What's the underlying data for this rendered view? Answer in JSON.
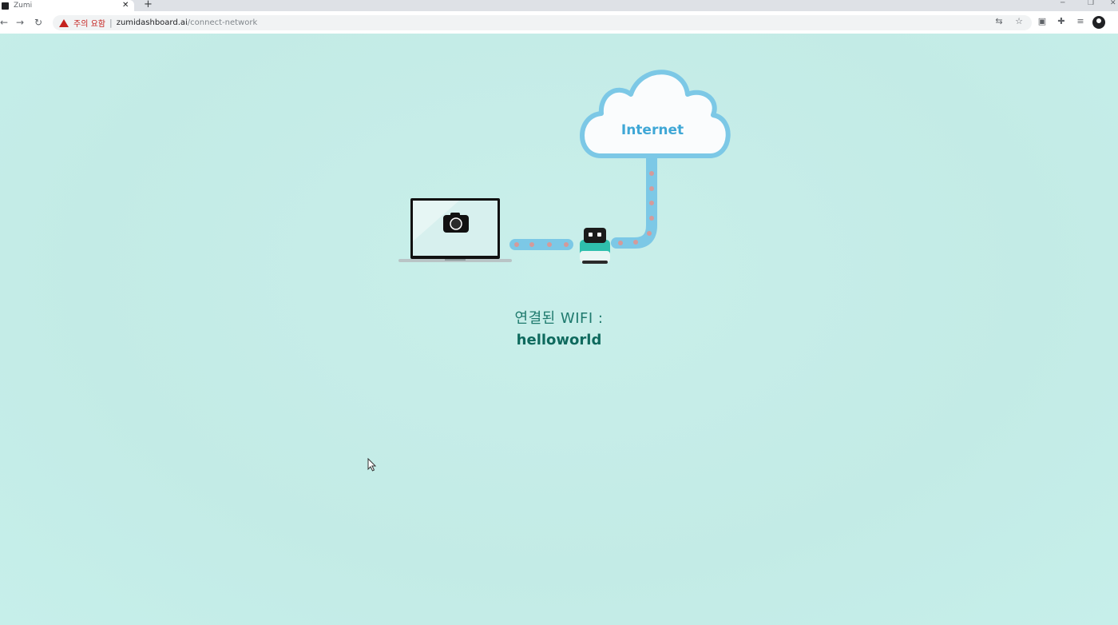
{
  "browser": {
    "tab_title": "Zumi",
    "tab_close": "✕",
    "new_tab": "+",
    "security_warning": "주의 요함",
    "url_host": "zumidashboard.ai",
    "url_path": "/connect-network"
  },
  "diagram": {
    "cloud_label": "Internet",
    "laptop_icon": "camera-icon",
    "robot_icon": "zumi-robot-icon"
  },
  "connection": {
    "label": "연결된 WIFI :",
    "network_name": "helloworld"
  },
  "colors": {
    "background": "#c4ece7",
    "cloud_stroke": "#7cc8e6",
    "cloud_text": "#3fa7d6",
    "link_pipe": "#7cc8e6",
    "link_dots": "#d49a9a",
    "wifi_text": "#1f7a6e"
  }
}
